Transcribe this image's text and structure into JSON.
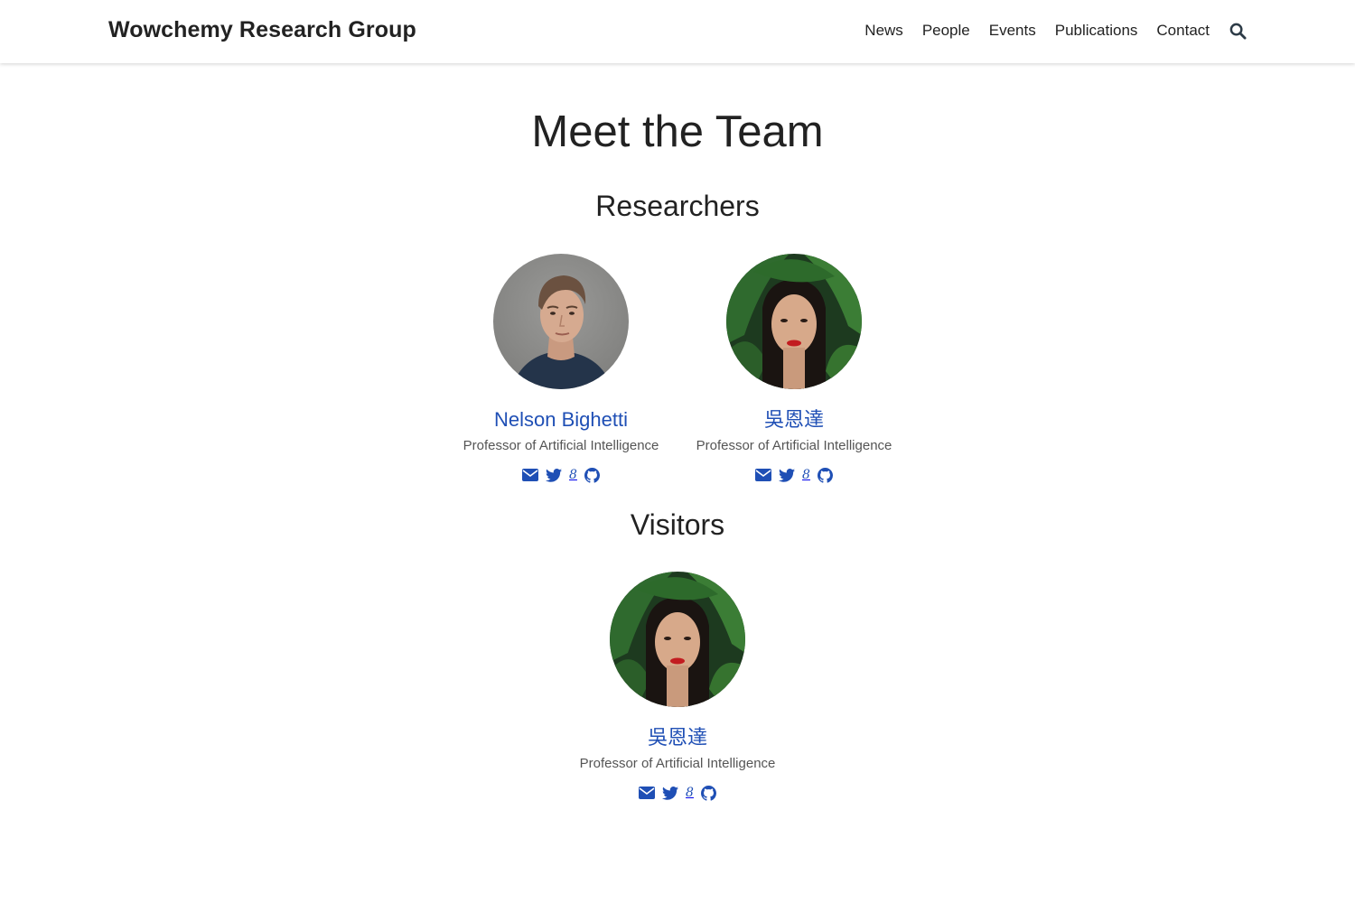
{
  "site": {
    "brand": "Wowchemy Research Group"
  },
  "nav": {
    "items": [
      "News",
      "People",
      "Events",
      "Publications",
      "Contact"
    ]
  },
  "page": {
    "title": "Meet the Team"
  },
  "sections": {
    "researchers": {
      "title": "Researchers",
      "members": [
        {
          "name": "Nelson Bighetti",
          "role": "Professor of Artificial Intelligence",
          "avatar": "man-portrait"
        },
        {
          "name": "吳恩達",
          "role": "Professor of Artificial Intelligence",
          "avatar": "woman-portrait-leaves"
        }
      ]
    },
    "visitors": {
      "title": "Visitors",
      "members": [
        {
          "name": "吳恩達",
          "role": "Professor of Artificial Intelligence",
          "avatar": "woman-portrait-leaves"
        }
      ]
    }
  },
  "social_icons": [
    "envelope-icon",
    "twitter-icon",
    "google-scholar-icon",
    "github-icon"
  ],
  "colors": {
    "link": "#1f4fb5",
    "text": "#222222",
    "muted": "#555555"
  }
}
